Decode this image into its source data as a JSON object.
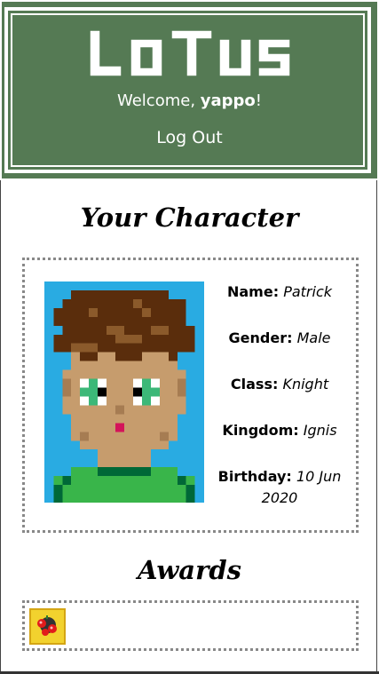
{
  "header": {
    "logo_text": "LOTUS",
    "welcome_prefix": "Welcome, ",
    "username": "yappo",
    "welcome_suffix": "!",
    "logout_label": "Log Out"
  },
  "character": {
    "section_title": "Your Character",
    "fields": [
      {
        "label": "Name:",
        "value": "Patrick"
      },
      {
        "label": "Gender:",
        "value": "Male"
      },
      {
        "label": "Class:",
        "value": "Knight"
      },
      {
        "label": "Kingdom:",
        "value": "Ignis"
      },
      {
        "label": "Birthday:",
        "value": "10 Jun 2020"
      }
    ]
  },
  "awards": {
    "section_title": "Awards",
    "items": [
      {
        "icon": "award-badge-icon"
      }
    ]
  },
  "colors": {
    "header_bg": "#557a54",
    "portrait_bg": "#29abe2",
    "hair": "#5a2d0c",
    "skin": "#c69c6d",
    "shirt": "#39b54a",
    "eyes": "#3cb878"
  }
}
